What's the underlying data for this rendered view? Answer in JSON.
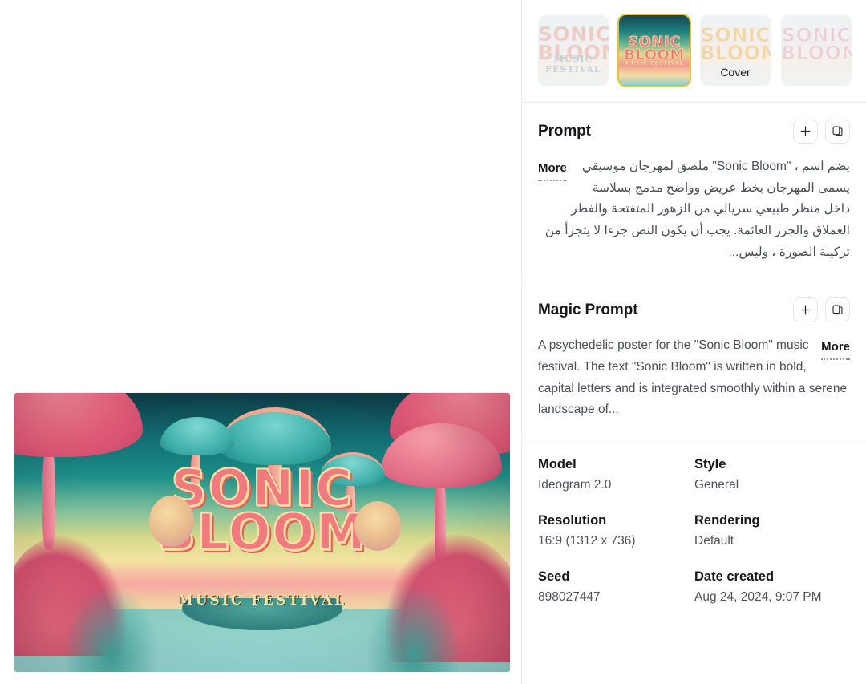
{
  "thumbnails": [
    {
      "name": "thumbnail-1",
      "title_line1": "SONIC",
      "title_line2": "BLOOM",
      "subtitle": "MUSIC FESTIVAL",
      "variant": "pale",
      "selected": false,
      "badge": ""
    },
    {
      "name": "thumbnail-2",
      "title_line1": "SONIC",
      "title_line2": "BLOOM",
      "subtitle": "MUSIC FESTIVAL",
      "variant": "vivid",
      "selected": true,
      "badge": ""
    },
    {
      "name": "thumbnail-3",
      "title_line1": "SONIC",
      "title_line2": "BLOOM",
      "subtitle": "",
      "variant": "pale",
      "selected": false,
      "badge": "Cover"
    },
    {
      "name": "thumbnail-4",
      "title_line1": "SONIC",
      "title_line2": "BLOOM",
      "subtitle": "",
      "variant": "pale",
      "selected": false,
      "badge": ""
    }
  ],
  "preview": {
    "title_line1": "SONIC",
    "title_line2": "BLOOM",
    "subtitle": "MUSIC FESTIVAL"
  },
  "prompt": {
    "title": "Prompt",
    "text": "يضم اسم ، \"Sonic Bloom\" ملصق لمهرجان موسيقي يسمى المهرجان بخط عريض وواضح مدمج بسلاسة داخل منظر طبيعي سريالي من الزهور المتفتحة والفطر العملاق والجزر العائمة. يجب أن يكون النص جزءا لا يتجزأ من تركيبة الصورة ، وليس...",
    "more_label": "More",
    "add_icon": "plus-icon",
    "copy_icon": "copy-icon"
  },
  "magic_prompt": {
    "title": "Magic Prompt",
    "text": "A psychedelic poster for the \"Sonic Bloom\" music festival. The text \"Sonic Bloom\" is written in bold, capital letters and is integrated smoothly within a serene landscape of...",
    "more_label": "More",
    "add_icon": "plus-icon",
    "copy_icon": "copy-icon"
  },
  "metadata": [
    {
      "label": "Model",
      "value": "Ideogram 2.0"
    },
    {
      "label": "Style",
      "value": "General"
    },
    {
      "label": "Resolution",
      "value": "16:9 (1312 x 736)"
    },
    {
      "label": "Rendering",
      "value": "Default"
    },
    {
      "label": "Seed",
      "value": "898027447"
    },
    {
      "label": "Date created",
      "value": "Aug 24, 2024, 9:07 PM"
    }
  ],
  "colors": {
    "selection": "#e9c23a",
    "text_primary": "#16181c",
    "text_secondary": "#4a4f56",
    "divider": "#eeeeee",
    "badge_bg": "#f1f1f1"
  }
}
